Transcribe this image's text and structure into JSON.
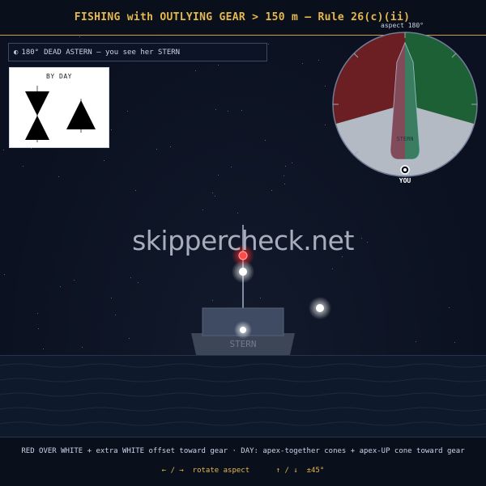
{
  "header": {
    "title": "FISHING with OUTLYING GEAR > 150 m — Rule 26(c)(ii)"
  },
  "aspect_info": {
    "icon": "compass-icon",
    "glyph": "◐",
    "degrees": "180°",
    "text": "DEAD ASTERN — you see her STERN"
  },
  "day_shapes": {
    "title": "BY DAY",
    "shapes": [
      "cones-apex-together",
      "cone-apex-up"
    ]
  },
  "dial": {
    "aspect_label": "aspect 180°",
    "vessel_label": "STERN",
    "observer_label": "YOU",
    "colors": {
      "port_sector": "#c0392b",
      "starboard_sector": "#27ae60",
      "stern_sector": "#d8dde4"
    }
  },
  "scene": {
    "hull_label": "STERN",
    "lights": [
      {
        "name": "masthead-red-light",
        "color": "#ff3b3b"
      },
      {
        "name": "masthead-white-light",
        "color": "#ffffff"
      },
      {
        "name": "outlying-gear-white-light",
        "color": "#ffffff"
      },
      {
        "name": "stern-white-light",
        "color": "#ffffff"
      }
    ]
  },
  "watermark": "skippercheck.net",
  "footer": {
    "description": "RED OVER WHITE + extra WHITE offset toward gear · DAY: apex-together cones + apex-UP cone toward gear",
    "rotate_keys": "← / →",
    "rotate_label": "rotate aspect",
    "tilt_keys": "↑ / ↓",
    "tilt_label": "±45°"
  }
}
